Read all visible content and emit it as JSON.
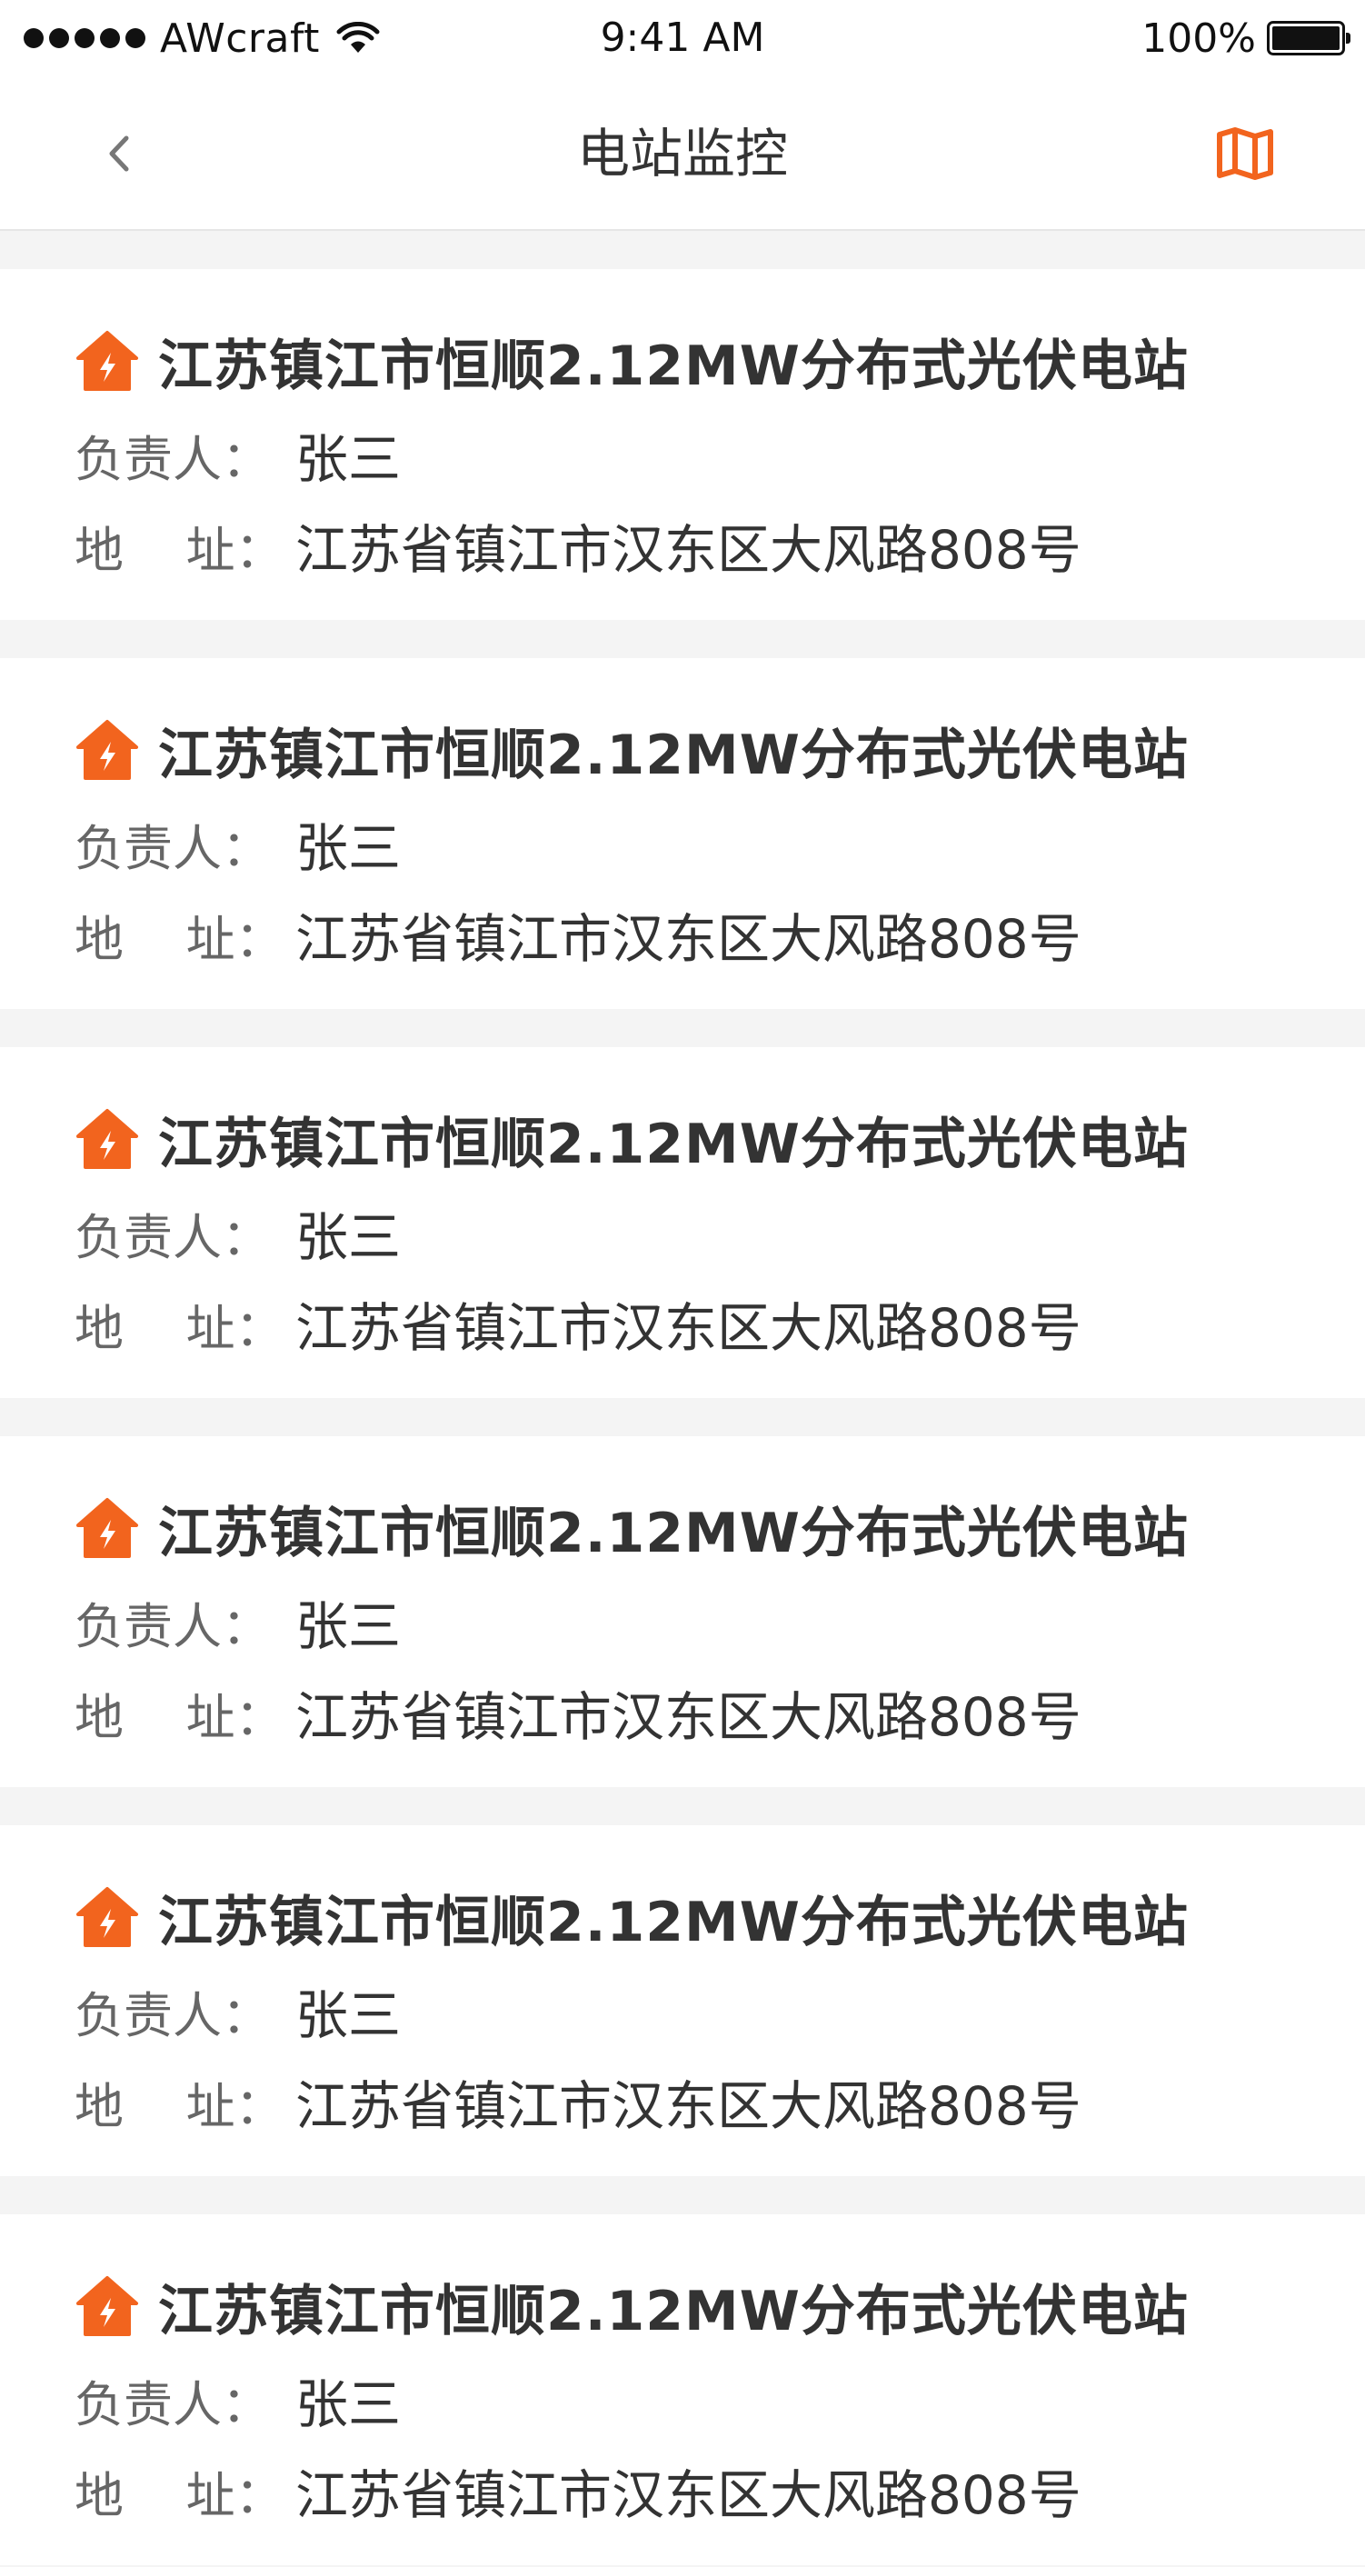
{
  "status_bar": {
    "carrier": "AWcraft",
    "time": "9:41 AM",
    "battery_percent": "100%",
    "battery_level": 1.0
  },
  "nav": {
    "title": "电站监控",
    "back_icon": "chevron-left-icon",
    "map_icon": "map-icon"
  },
  "colors": {
    "accent": "#f2641e",
    "background": "#f4f4f4",
    "card": "#ffffff",
    "title_text": "#333333",
    "label_text": "#666666"
  },
  "stations": [
    {
      "name": "江苏镇江市恒顺2.12MW分布式光伏电站",
      "owner_label": "负责人：",
      "owner": "张三",
      "address_label": "地    址：",
      "address": "江苏省镇江市汉东区大风路808号"
    },
    {
      "name": "江苏镇江市恒顺2.12MW分布式光伏电站",
      "owner_label": "负责人：",
      "owner": "张三",
      "address_label": "地    址：",
      "address": "江苏省镇江市汉东区大风路808号"
    },
    {
      "name": "江苏镇江市恒顺2.12MW分布式光伏电站",
      "owner_label": "负责人：",
      "owner": "张三",
      "address_label": "地    址：",
      "address": "江苏省镇江市汉东区大风路808号"
    },
    {
      "name": "江苏镇江市恒顺2.12MW分布式光伏电站",
      "owner_label": "负责人：",
      "owner": "张三",
      "address_label": "地    址：",
      "address": "江苏省镇江市汉东区大风路808号"
    },
    {
      "name": "江苏镇江市恒顺2.12MW分布式光伏电站",
      "owner_label": "负责人：",
      "owner": "张三",
      "address_label": "地    址：",
      "address": "江苏省镇江市汉东区大风路808号"
    },
    {
      "name": "江苏镇江市恒顺2.12MW分布式光伏电站",
      "owner_label": "负责人：",
      "owner": "张三",
      "address_label": "地    址：",
      "address": "江苏省镇江市汉东区大风路808号"
    }
  ]
}
